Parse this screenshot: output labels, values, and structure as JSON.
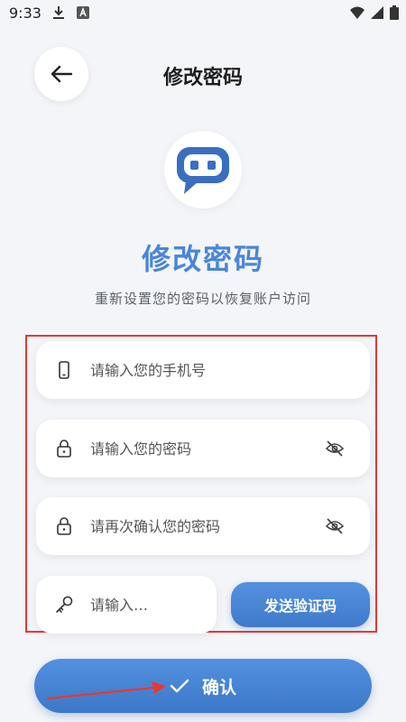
{
  "status_bar": {
    "time": "9:33",
    "icons": [
      "download-icon",
      "a-icon",
      "wifi-icon",
      "signal-icon",
      "battery-icon"
    ]
  },
  "header": {
    "title": "修改密码",
    "back_icon": "arrow-left-icon"
  },
  "hero": {
    "logo_icon": "chat-bubble-logo-icon",
    "title": "修改密码",
    "subtitle": "重新设置您的密码以恢复账户访问"
  },
  "form": {
    "phone": {
      "placeholder": "请输入您的手机号",
      "value": "",
      "icon": "phone-icon"
    },
    "password": {
      "placeholder": "请输入您的密码",
      "value": "",
      "icon": "lock-icon",
      "toggle_icon": "eye-off-icon"
    },
    "confirm_password": {
      "placeholder": "请再次确认您的密码",
      "value": "",
      "icon": "lock-icon",
      "toggle_icon": "eye-off-icon"
    },
    "code": {
      "placeholder": "请输入…",
      "value": "",
      "icon": "key-icon"
    },
    "send_code_label": "发送验证码"
  },
  "confirm_button": {
    "label": "确认",
    "icon": "check-icon"
  },
  "colors": {
    "accent": "#4a86d8",
    "button": "#3f7acb",
    "annotation": "#e53935",
    "background": "#f3f5f8"
  }
}
